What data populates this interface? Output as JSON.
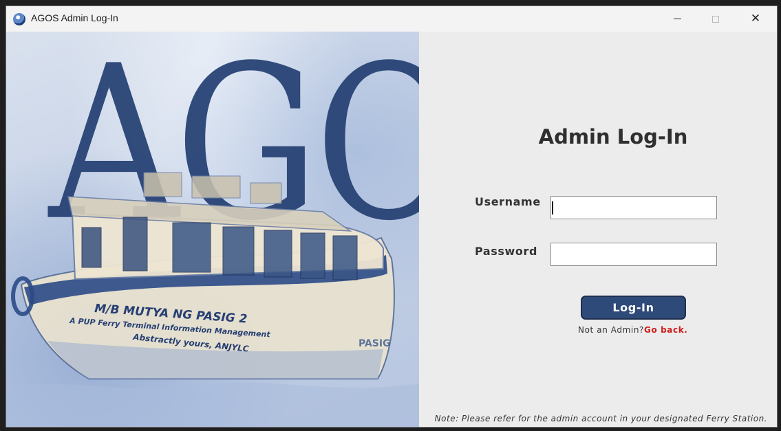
{
  "window": {
    "title": "AGOS Admin Log-In",
    "close_symbol": "✕"
  },
  "hero": {
    "logo_text": "AGOS",
    "boat_name": "M/B MUTYA NG PASIG 2",
    "boat_tagline": "A PUP Ferry Terminal Information Management",
    "boat_signature": "Abstractly yours, ANJYLC",
    "boat_side_text": "PASIG"
  },
  "form": {
    "heading": "Admin Log-In",
    "username_label": "Username",
    "username_value": "",
    "password_label": "Password",
    "password_value": "",
    "login_button": "Log-In",
    "not_admin_text": "Not an Admin?",
    "go_back_link": "Go back.",
    "note": "Note: Please refer for the admin account in your designated Ferry Station."
  },
  "colors": {
    "button_bg": "#2e4a78",
    "link": "#d01c1c",
    "panel_bg": "#ececec",
    "logo": "#233f72"
  },
  "icons": {
    "app": "ferry-logo-icon",
    "minimize": "minimize-icon",
    "maximize": "maximize-icon",
    "close": "close-icon"
  }
}
